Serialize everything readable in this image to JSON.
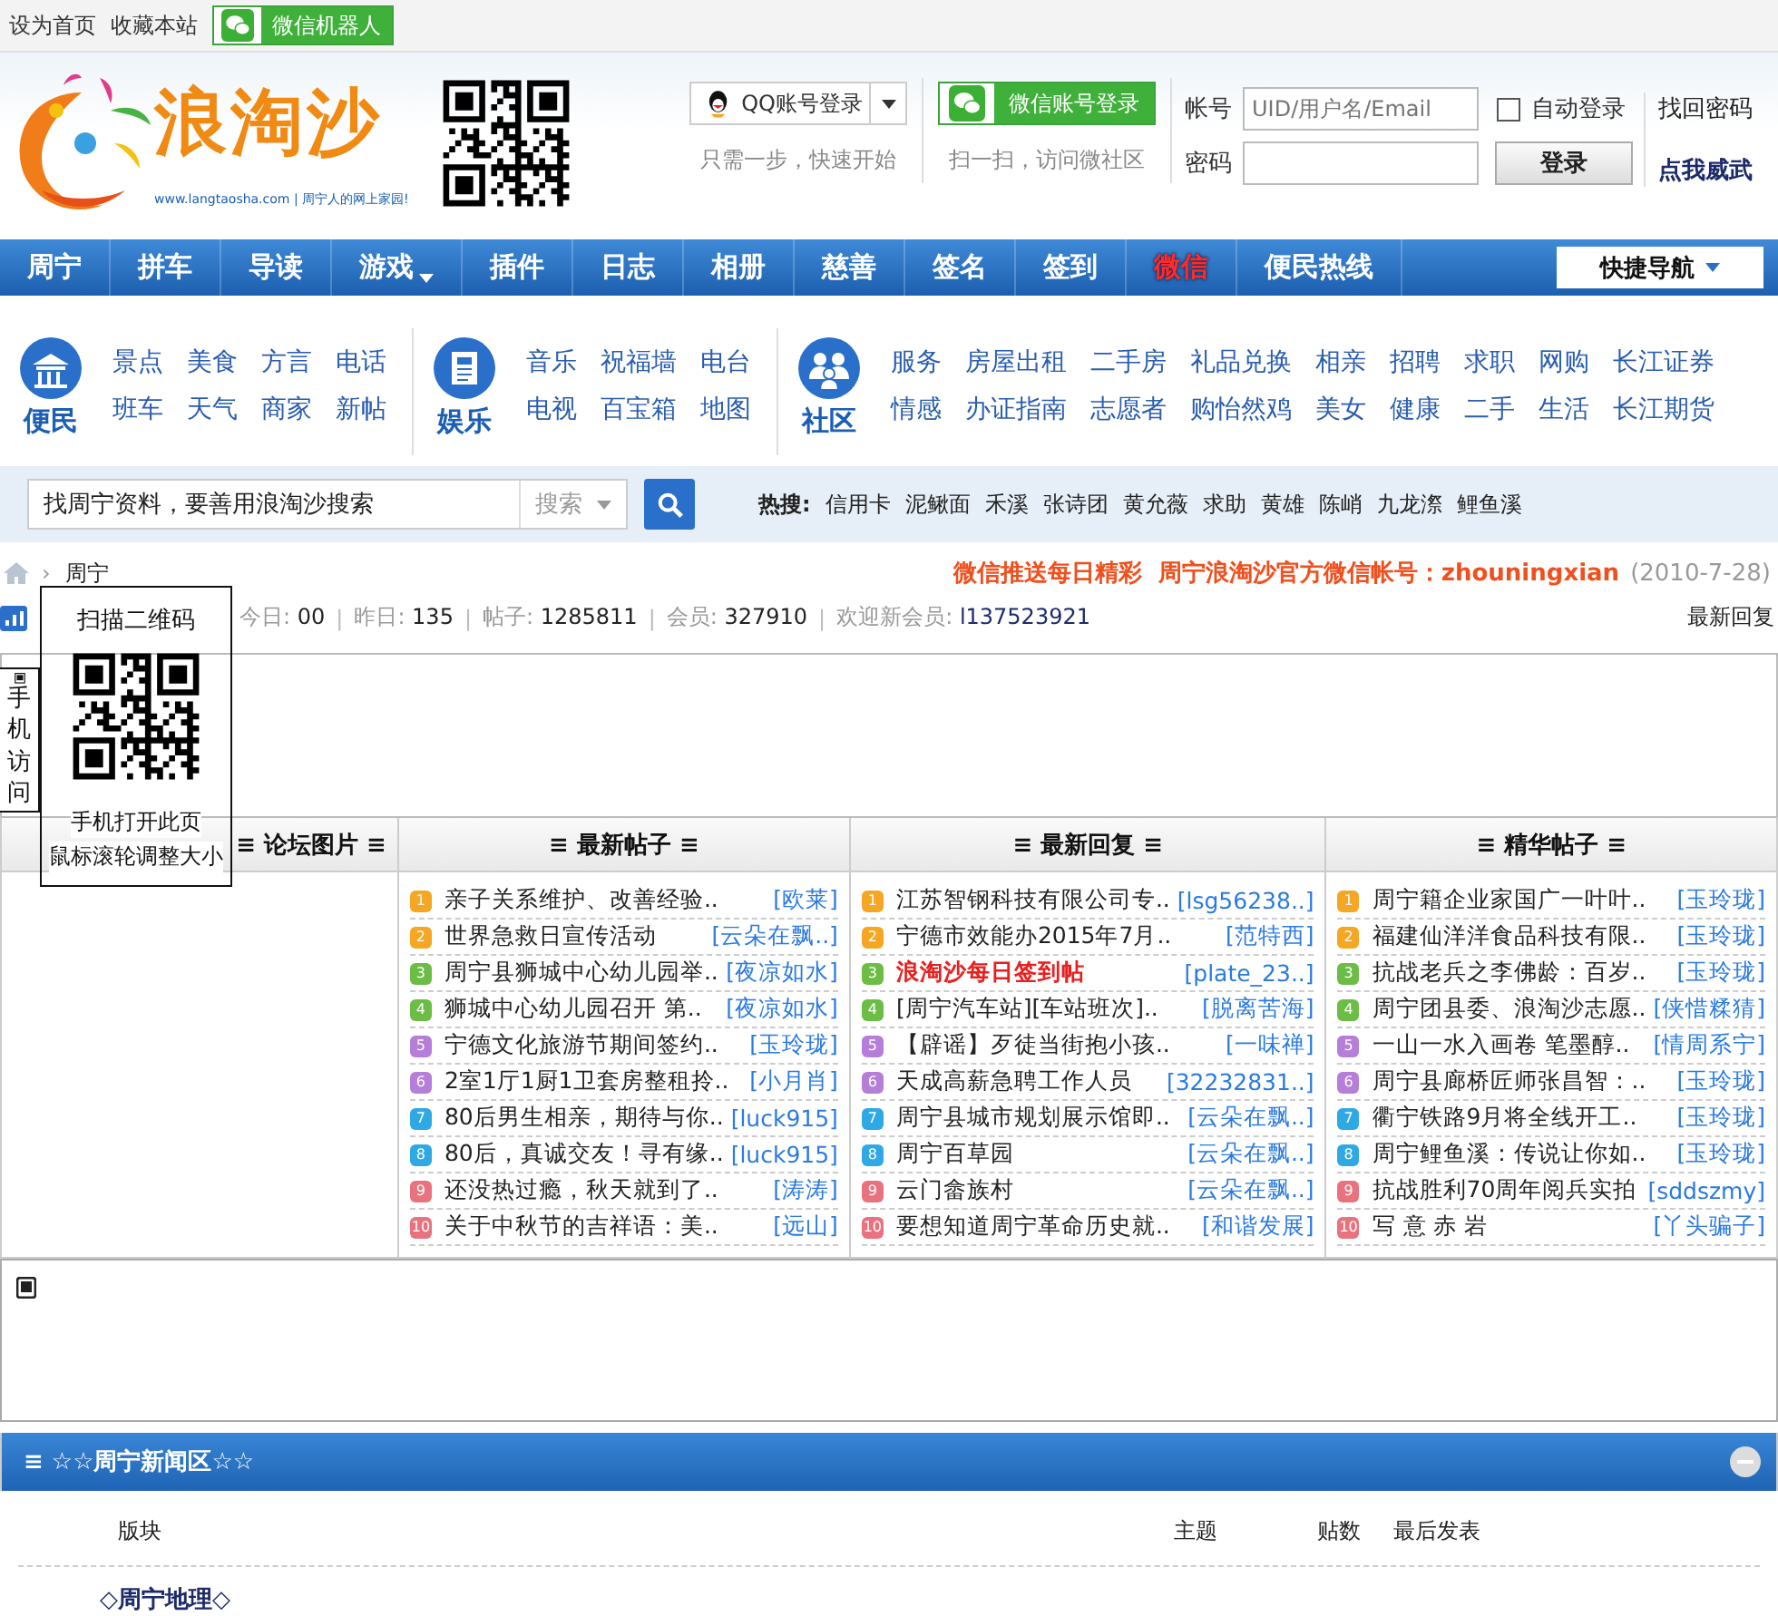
{
  "top_bar": {
    "links": [
      "设为首页",
      "收藏本站"
    ],
    "wechat_robot": "微信机器人"
  },
  "header": {
    "logo": {
      "name": "浪淘沙",
      "tagline": "www.langtaosha.com | 周宁人的网上家园!"
    },
    "qq_login": {
      "label": "QQ账号登录",
      "hint": "只需一步，快速开始"
    },
    "wechat_login": {
      "label": "微信账号登录",
      "hint": "扫一扫，访问微社区"
    },
    "login_form": {
      "account": {
        "label": "帐号",
        "placeholder": "UID/用户名/Email"
      },
      "password": {
        "label": "密码"
      },
      "auto_login": {
        "label": "自动登录",
        "checked": false
      },
      "submit": "登录",
      "links": [
        "找回密码",
        "点我威武"
      ]
    }
  },
  "nav": {
    "items": [
      {
        "label": "周宁",
        "highlighted": false,
        "dropdown": false
      },
      {
        "label": "拼车",
        "highlighted": false,
        "dropdown": false
      },
      {
        "label": "导读",
        "highlighted": false,
        "dropdown": false
      },
      {
        "label": "游戏",
        "highlighted": false,
        "dropdown": true
      },
      {
        "label": "插件",
        "highlighted": false,
        "dropdown": false
      },
      {
        "label": "日志",
        "highlighted": false,
        "dropdown": false
      },
      {
        "label": "相册",
        "highlighted": false,
        "dropdown": false
      },
      {
        "label": "慈善",
        "highlighted": false,
        "dropdown": false
      },
      {
        "label": "签名",
        "highlighted": false,
        "dropdown": false
      },
      {
        "label": "签到",
        "highlighted": false,
        "dropdown": false
      },
      {
        "label": "微信",
        "highlighted": true,
        "dropdown": false
      },
      {
        "label": "便民热线",
        "highlighted": false,
        "dropdown": false
      }
    ],
    "quick_nav": "快捷导航"
  },
  "quick_links": [
    {
      "name": "便民",
      "kind": "building",
      "rows": [
        [
          "景点",
          "美食",
          "方言",
          "电话"
        ],
        [
          "班车",
          "天气",
          "商家",
          "新帖"
        ]
      ]
    },
    {
      "name": "娱乐",
      "kind": "news",
      "rows": [
        [
          "音乐",
          "祝福墙",
          "电台"
        ],
        [
          "电视",
          "百宝箱",
          "地图"
        ]
      ]
    },
    {
      "name": "社区",
      "kind": "people",
      "rows": [
        [
          "服务",
          "房屋出租",
          "二手房",
          "礼品兑换",
          "相亲",
          "招聘",
          "求职",
          "网购",
          "长江证券"
        ],
        [
          "情感",
          "办证指南",
          "志愿者",
          "购怡然鸡",
          "美女",
          "健康",
          "二手",
          "生活",
          "长江期货"
        ]
      ]
    }
  ],
  "search": {
    "value": "找周宁资料，要善用浪淘沙搜索",
    "scope": "搜索",
    "hot_label": "热搜:",
    "hot": [
      "信用卡",
      "泥鳅面",
      "禾溪",
      "张诗团",
      "黄允薇",
      "求助",
      "黄雄",
      "陈峭",
      "九龙漈",
      "鲤鱼溪"
    ]
  },
  "breadcrumb": {
    "separator": "›",
    "items": [
      "周宁"
    ],
    "notice": "微信推送每日精彩  周宁浪淘沙官方微信帐号：zhouningxian",
    "date": "(2010-7-28)"
  },
  "stats": {
    "separator": "|",
    "items": [
      {
        "label": "今日:",
        "value": "00"
      },
      {
        "label": "昨日:",
        "value": "135"
      },
      {
        "label": "帖子:",
        "value": "1285811"
      },
      {
        "label": "会员:",
        "value": "327910"
      },
      {
        "label": "欢迎新会员:",
        "value": "l137523921"
      }
    ],
    "latest_replies": "最新回复"
  },
  "board": {
    "columns": [
      {
        "title": "≡ 论坛图片 ≡"
      },
      {
        "title": "≡ 最新帖子 ≡",
        "items": [
          {
            "rank": "1",
            "color": "#f5a623",
            "title": "亲子关系维护、改善经验..",
            "author": "[欧莱]"
          },
          {
            "rank": "2",
            "color": "#f5a623",
            "title": "世界急救日宣传活动",
            "author": "[云朵在飘..]"
          },
          {
            "rank": "3",
            "color": "#6cbd45",
            "title": "周宁县狮城中心幼儿园举..",
            "author": "[夜凉如水]"
          },
          {
            "rank": "4",
            "color": "#6cbd45",
            "title": "狮城中心幼儿园召开 第..",
            "author": "[夜凉如水]"
          },
          {
            "rank": "5",
            "color": "#b57ed8",
            "title": "宁德文化旅游节期间签约..",
            "author": "[玉玲珑]"
          },
          {
            "rank": "6",
            "color": "#b57ed8",
            "title": "2室1厅1厨1卫套房整租拎..",
            "author": "[小月肖]"
          },
          {
            "rank": "7",
            "color": "#2fa8e6",
            "title": "80后男生相亲，期待与你..",
            "author": "[luck915]"
          },
          {
            "rank": "8",
            "color": "#2fa8e6",
            "title": "80后，真诚交友！寻有缘..",
            "author": "[luck915]"
          },
          {
            "rank": "9",
            "color": "#e8737f",
            "title": "还没热过瘾，秋天就到了..",
            "author": "[涛涛]"
          },
          {
            "rank": "10",
            "color": "#e8737f",
            "title": "关于中秋节的吉祥语：美..",
            "author": "[远山]"
          }
        ]
      },
      {
        "title": "≡ 最新回复 ≡",
        "items": [
          {
            "rank": "1",
            "color": "#f5a623",
            "title": "江苏智钢科技有限公司专..",
            "author": "[lsg56238..]",
            "highlighted": false
          },
          {
            "rank": "2",
            "color": "#f5a623",
            "title": "宁德市效能办2015年7月..",
            "author": "[范特西]",
            "highlighted": false
          },
          {
            "rank": "3",
            "color": "#6cbd45",
            "title": "浪淘沙每日签到帖",
            "author": "[plate_23..]",
            "highlighted": true
          },
          {
            "rank": "4",
            "color": "#6cbd45",
            "title": "[周宁汽车站][车站班次]..",
            "author": "[脱离苦海]",
            "highlighted": false
          },
          {
            "rank": "5",
            "color": "#b57ed8",
            "title": "【辟谣】歹徒当街抱小孩..",
            "author": "[一味禅]",
            "highlighted": false
          },
          {
            "rank": "6",
            "color": "#b57ed8",
            "title": "天成高薪急聘工作人员",
            "author": "[32232831..]",
            "highlighted": false
          },
          {
            "rank": "7",
            "color": "#2fa8e6",
            "title": "周宁县城市规划展示馆即..",
            "author": "[云朵在飘..]",
            "highlighted": false
          },
          {
            "rank": "8",
            "color": "#2fa8e6",
            "title": "周宁百草园",
            "author": "[云朵在飘..]",
            "highlighted": false
          },
          {
            "rank": "9",
            "color": "#e8737f",
            "title": "云门畲族村",
            "author": "[云朵在飘..]",
            "highlighted": false
          },
          {
            "rank": "10",
            "color": "#e8737f",
            "title": "要想知道周宁革命历史就..",
            "author": "[和谐发展]",
            "highlighted": false
          }
        ]
      },
      {
        "title": "≡ 精华帖子 ≡",
        "items": [
          {
            "rank": "1",
            "color": "#f5a623",
            "title": "周宁籍企业家国广一叶叶..",
            "author": "[玉玲珑]"
          },
          {
            "rank": "2",
            "color": "#f5a623",
            "title": "福建仙洋洋食品科技有限..",
            "author": "[玉玲珑]"
          },
          {
            "rank": "3",
            "color": "#6cbd45",
            "title": "抗战老兵之李佛龄：百岁..",
            "author": "[玉玲珑]"
          },
          {
            "rank": "4",
            "color": "#6cbd45",
            "title": "周宁团县委、浪淘沙志愿..",
            "author": "[侠惜糅猜]"
          },
          {
            "rank": "5",
            "color": "#b57ed8",
            "title": "一山一水入画卷 笔墨醇..",
            "author": "[情周系宁]"
          },
          {
            "rank": "6",
            "color": "#b57ed8",
            "title": "周宁县廊桥匠师张昌智：..",
            "author": "[玉玲珑]"
          },
          {
            "rank": "7",
            "color": "#2fa8e6",
            "title": "衢宁铁路9月将全线开工..",
            "author": "[玉玲珑]"
          },
          {
            "rank": "8",
            "color": "#2fa8e6",
            "title": "周宁鲤鱼溪：传说让你如..",
            "author": "[玉玲珑]"
          },
          {
            "rank": "9",
            "color": "#e8737f",
            "title": "抗战胜利70周年阅兵实拍",
            "author": "[sddszmy]"
          },
          {
            "rank": "10",
            "color": "#e8737f",
            "title": "写 意 赤 岩",
            "author": "[丫头骗子]"
          }
        ]
      }
    ]
  },
  "qr_popup": {
    "title": "扫描二维码",
    "lines": [
      "手机打开此页",
      "鼠标滚轮调整大小"
    ]
  },
  "mobile_tab": "手机访问",
  "section": {
    "title": "≡ ☆☆周宁新闻区☆☆",
    "expanded": true,
    "columns": [
      "版块",
      "主题",
      "贴数",
      "最后发表"
    ],
    "forums": [
      {
        "name": "◇周宁地理◇"
      }
    ]
  }
}
